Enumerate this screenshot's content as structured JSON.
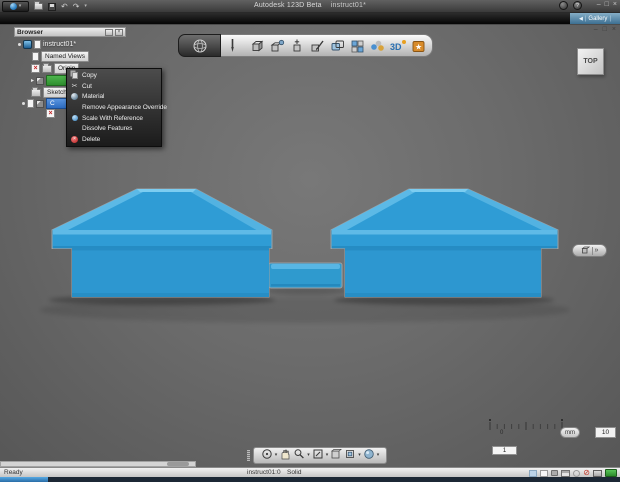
{
  "titlebar": {
    "app_name": "Autodesk 123D Beta",
    "doc_name": "instruct01*",
    "help_glyph": "?"
  },
  "glyphs": {
    "caret": "▾",
    "back": "◀",
    "pipe": "|",
    "min": "–",
    "max": "□",
    "close": "×",
    "undo": "↶",
    "redo": "↷",
    "scissors": "✂",
    "chevrons": "»",
    "no_entry": "⊘",
    "expand": "▸"
  },
  "gallery": {
    "label": "Gallery"
  },
  "browser": {
    "title": "Browser",
    "root": "instruct01*",
    "named_views": "Named Views",
    "origin": "Origin",
    "sketches": "Sketches",
    "selected_partial": "C"
  },
  "menu": {
    "items": [
      "Copy",
      "Cut",
      "Material",
      "Remove Appearance Override",
      "Scale With Reference",
      "Dissolve Features",
      "Delete"
    ]
  },
  "viewcube": {
    "face": "TOP"
  },
  "ruler": {
    "zero": "0",
    "scale": "1",
    "units": "mm",
    "grid": "10"
  },
  "statusbar": {
    "status": "Ready",
    "doc": "instruct01:0",
    "mode": "Solid"
  },
  "colors": {
    "model_blue": "#2f9cd5",
    "model_highlight": "#5cb9e6",
    "selection_green": "#3aa23a",
    "selection_blue": "#3c7fd0",
    "gallery_tab_blue": "#3c6f92"
  }
}
